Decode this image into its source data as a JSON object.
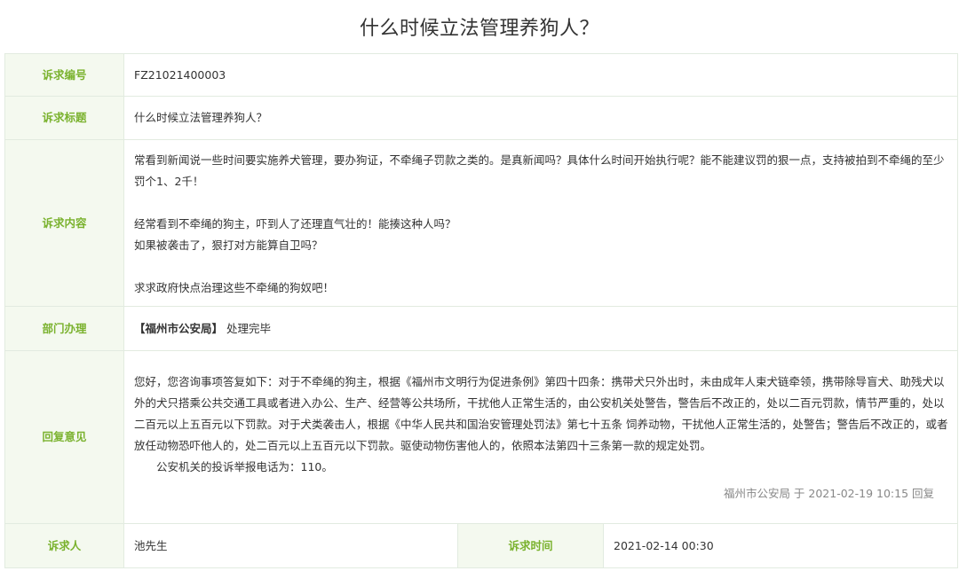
{
  "title": "什么时候立法管理养狗人？",
  "labels": {
    "code": "诉求编号",
    "subject": "诉求标题",
    "content": "诉求内容",
    "department": "部门办理",
    "reply": "回复意见",
    "petitioner": "诉求人",
    "time": "诉求时间"
  },
  "petition": {
    "code": "FZ21021400003",
    "subject": "什么时候立法管理养狗人？",
    "content": [
      "常看到新闻说一些时间要实施养犬管理，要办狗证，不牵绳子罚款之类的。是真新闻吗？具体什么时间开始执行呢？能不能建议罚的狠一点，支持被拍到不牵绳的至少罚个1、2千！",
      "经常看到不牵绳的狗主，吓到人了还理直气壮的！能揍这种人吗？\n如果被袭击了，狠打对方能算自卫吗？",
      "求求政府快点治理这些不牵绳的狗奴吧！"
    ],
    "department": {
      "name": "【福州市公安局】",
      "status": "处理完毕"
    },
    "reply": {
      "body": "您好，您咨询事项答复如下：对于不牵绳的狗主，根据《福州市文明行为促进条例》第四十四条：携带犬只外出时，未由成年人束犬链牵领，携带除导盲犬、助残犬以外的犬只搭乘公共交通工具或者进入办公、生产、经营等公共场所，干扰他人正常生活的，由公安机关处警告，警告后不改正的，处以二百元罚款，情节严重的，处以二百元以上五百元以下罚款。对于犬类袭击人，根据《中华人民共和国治安管理处罚法》第七十五条 饲养动物，干扰他人正常生活的，处警告；警告后不改正的，或者放任动物恐吓他人的，处二百元以上五百元以下罚款。驱使动物伤害他人的，依照本法第四十三条第一款的规定处罚。",
      "hotline": "公安机关的投诉举报电话为：110。",
      "signature": "福州市公安局 于 2021-02-19 10:15 回复"
    },
    "petitioner": "池先生",
    "time": "2021-02-14 00:30"
  }
}
